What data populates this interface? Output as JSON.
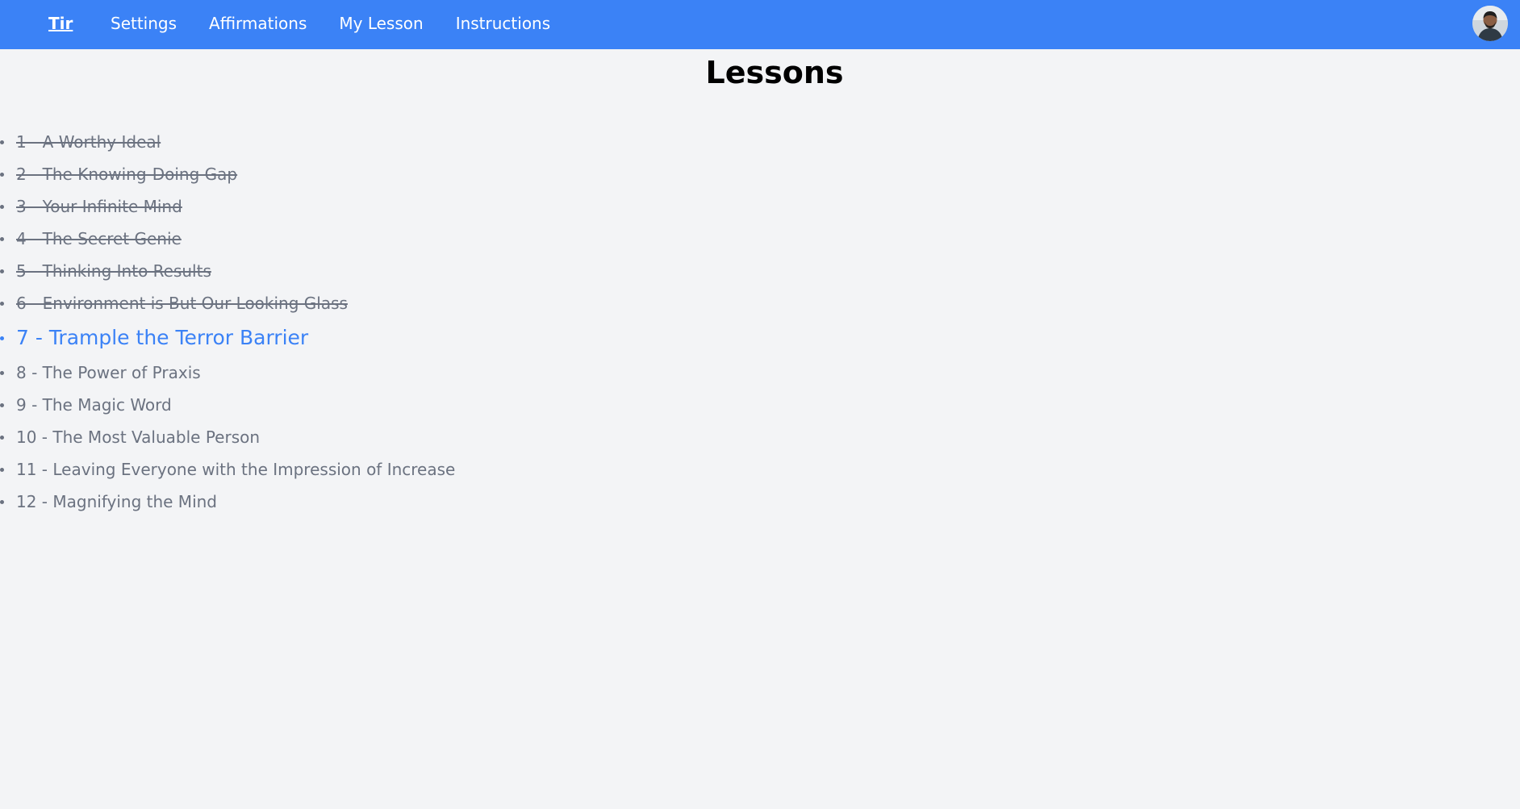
{
  "nav": {
    "brand": "Tir",
    "links": [
      "Settings",
      "Affirmations",
      "My Lesson",
      "Instructions"
    ]
  },
  "page_title": "Lessons",
  "lessons": [
    {
      "label": "1 - A Worthy Ideal",
      "status": "done"
    },
    {
      "label": "2 - The Knowing-Doing Gap",
      "status": "done"
    },
    {
      "label": "3 - Your Infinite Mind",
      "status": "done"
    },
    {
      "label": "4 - The Secret Genie",
      "status": "done"
    },
    {
      "label": "5 - Thinking Into Results",
      "status": "done"
    },
    {
      "label": "6 - Environment is But Our Looking Glass",
      "status": "done"
    },
    {
      "label": "7 - Trample the Terror Barrier",
      "status": "current"
    },
    {
      "label": "8 - The Power of Praxis",
      "status": "upcoming"
    },
    {
      "label": "9 - The Magic Word",
      "status": "upcoming"
    },
    {
      "label": "10 - The Most Valuable Person",
      "status": "upcoming"
    },
    {
      "label": "11 - Leaving Everyone with the Impression of Increase",
      "status": "upcoming"
    },
    {
      "label": "12 - Magnifying the Mind",
      "status": "upcoming"
    }
  ],
  "colors": {
    "navbar": "#3b82f6",
    "background": "#f3f4f6",
    "current_lesson": "#3b82f6",
    "lesson_text": "#6b7280"
  },
  "icons": {
    "avatar": "user-avatar-photo"
  }
}
